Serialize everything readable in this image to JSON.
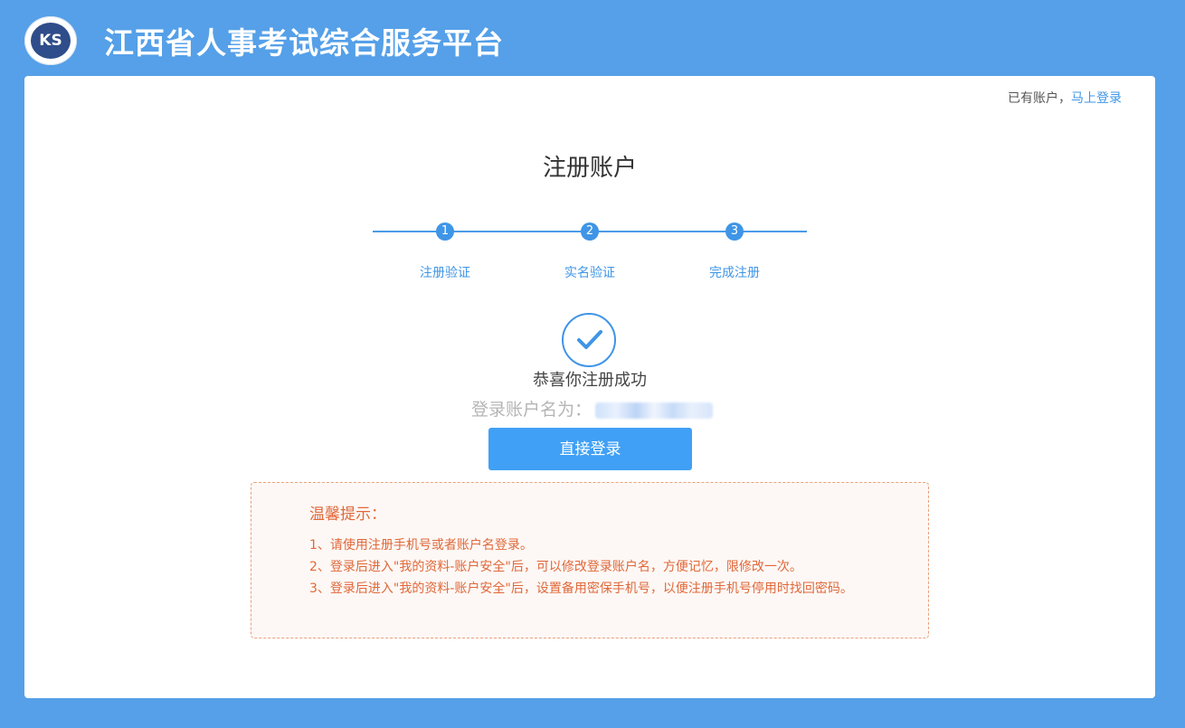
{
  "header": {
    "site_title": "江西省人事考试综合服务平台",
    "logo_mark": "KS"
  },
  "topbar": {
    "has_account_text": "已有账户，",
    "login_link": "马上登录"
  },
  "page_title": "注册账户",
  "steps": [
    {
      "number": "1",
      "label": "注册验证"
    },
    {
      "number": "2",
      "label": "实名验证"
    },
    {
      "number": "3",
      "label": "完成注册"
    }
  ],
  "result": {
    "icon": "check-circle-icon",
    "message": "恭喜你注册成功",
    "account_label": "登录账户名为："
  },
  "login_button_label": "直接登录",
  "tips": {
    "title": "温馨提示：",
    "items": [
      "1、请使用注册手机号或者账户名登录。",
      "2、登录后进入\"我的资料-账户安全\"后，可以修改登录账户名，方便记忆，限修改一次。",
      "3、登录后进入\"我的资料-账户安全\"后，设置备用密保手机号，以便注册手机号停用时找回密码。"
    ]
  },
  "colors": {
    "background": "#55a0e8",
    "accent": "#3f95e6",
    "button": "#40a0f5",
    "tip_text": "#e0683a"
  }
}
